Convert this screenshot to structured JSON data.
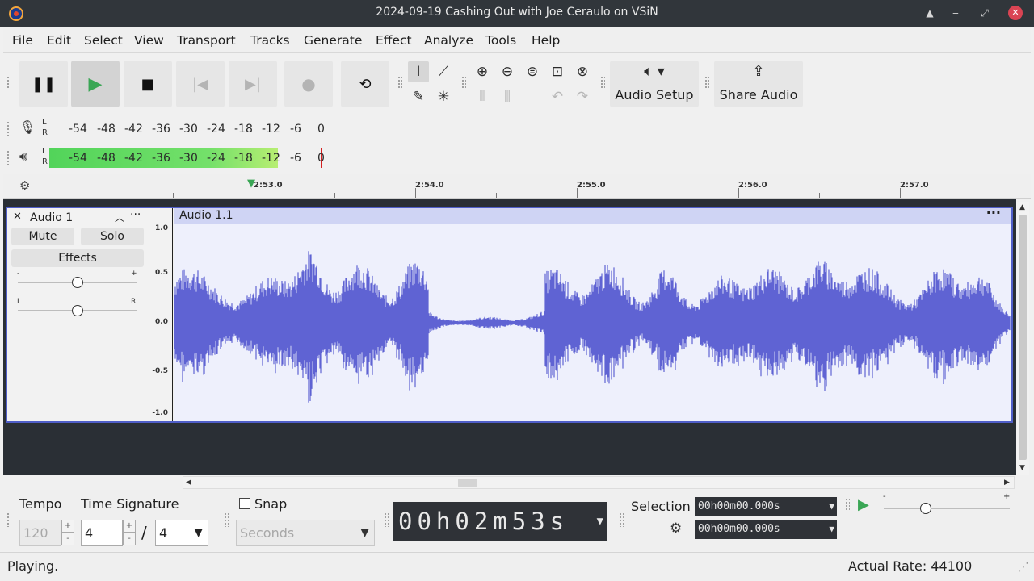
{
  "window": {
    "title": "2024-09-19 Cashing Out with Joe Ceraulo on VSiN"
  },
  "menu": [
    "File",
    "Edit",
    "Select",
    "View",
    "Transport",
    "Tracks",
    "Generate",
    "Effect",
    "Analyze",
    "Tools",
    "Help"
  ],
  "toolbar": {
    "audio_setup": "Audio Setup",
    "share_audio": "Share Audio"
  },
  "meters": {
    "lr_label": "L\nR",
    "ticks": [
      "-54",
      "-48",
      "-42",
      "-36",
      "-30",
      "-24",
      "-18",
      "-12",
      "-6",
      "0"
    ],
    "playback_level_db": -10
  },
  "ruler": {
    "labels": [
      "2:53.0",
      "2:54.0",
      "2:55.0",
      "2:56.0",
      "2:57.0"
    ]
  },
  "track": {
    "name": "Audio 1",
    "mute": "Mute",
    "solo": "Solo",
    "effects": "Effects",
    "gain_minus": "-",
    "gain_plus": "+",
    "pan_left": "L",
    "pan_right": "R",
    "clip_name": "Audio 1.1",
    "scale": [
      "1.0",
      "0.5",
      "0.0",
      "-0.5",
      "-1.0"
    ]
  },
  "bottom": {
    "tempo_label": "Tempo",
    "tempo_value": "120",
    "time_sig_label": "Time Signature",
    "time_sig_num": "4",
    "time_sig_slash": "/",
    "time_sig_den": "4",
    "snap_label": "Snap",
    "snap_unit": "Seconds",
    "time_display": "00h02m53s",
    "selection_label": "Selection",
    "sel_start": "00h00m00.000s",
    "sel_end": "00h00m00.000s"
  },
  "status": {
    "left": "Playing.",
    "right": "Actual Rate: 44100"
  },
  "colors": {
    "waveform": "#5f63d3",
    "clip_bg": "#eef0fc",
    "titlebar": "#31363b",
    "close": "#da4453"
  }
}
